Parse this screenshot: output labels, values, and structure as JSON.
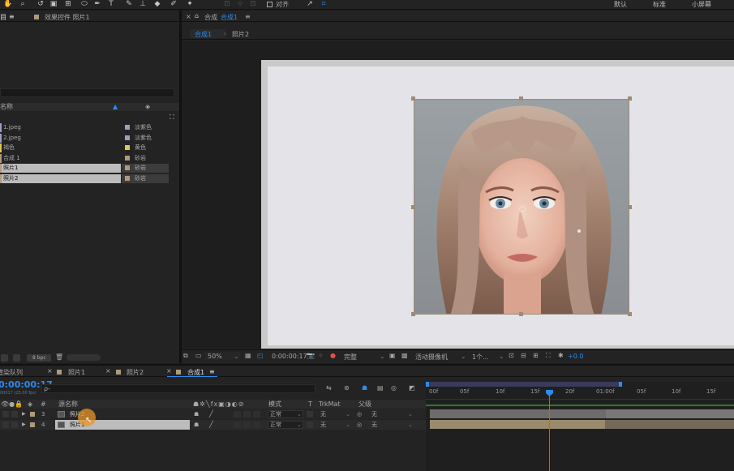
{
  "toolbar": {
    "align_label": "对齐",
    "workspaces": [
      "默认",
      "标准",
      "小屏幕"
    ]
  },
  "project_panel": {
    "tab_fragment": "目",
    "effects_tab": "效果控件 照片1",
    "col_name": "名称",
    "items": [
      {
        "name": "1.jpeg",
        "type": "淡紫色",
        "color": "#9c9ccc"
      },
      {
        "name": "2.jpeg",
        "type": "淡紫色",
        "color": "#9c9ccc"
      },
      {
        "name": "褐色",
        "type": "黄色",
        "color": "#e0c84a"
      },
      {
        "name": "合成 1",
        "type": "砂岩",
        "color": "#b09a7a"
      },
      {
        "name": "照片1",
        "type": "砂岩",
        "color": "#b09a7a"
      },
      {
        "name": "照片2",
        "type": "砂岩",
        "color": "#b09a7a"
      }
    ],
    "bpc": "8 bpc"
  },
  "comp_panel": {
    "tab_prefix": "合成",
    "tab_name": "合成1",
    "crumbs": [
      "合成1",
      "照片2"
    ],
    "footer": {
      "zoom": "50%",
      "timecode": "0:00:00:17",
      "quality": "完整",
      "camera": "活动摄像机",
      "views": "1个...",
      "exposure": "+0.0"
    }
  },
  "timeline": {
    "tabs": [
      "渲染队列",
      "照片1",
      "照片2",
      "合成1"
    ],
    "current_time": "0:00:00:17",
    "fps": "00017 (25.00 fps)",
    "search_placeholder": "ρ-",
    "col_hash": "#",
    "col_source": "源名称",
    "col_mode": "模式",
    "col_t": "T",
    "col_trkmat": "TrkMat",
    "col_parent": "父级",
    "layers": [
      {
        "num": "3",
        "name": "照片2",
        "mode": "正常",
        "trkmat": "无",
        "parent": "无"
      },
      {
        "num": "4",
        "name": "照片1",
        "mode": "正常",
        "trkmat": "无",
        "parent": "无"
      }
    ],
    "ticks": [
      "00f",
      "05f",
      "10f",
      "15f",
      "20f",
      "01:00f",
      "05f",
      "10f",
      "15f"
    ]
  },
  "colors": {
    "accent": "#2d8ceb",
    "label_sandstone": "#b09a7a"
  }
}
